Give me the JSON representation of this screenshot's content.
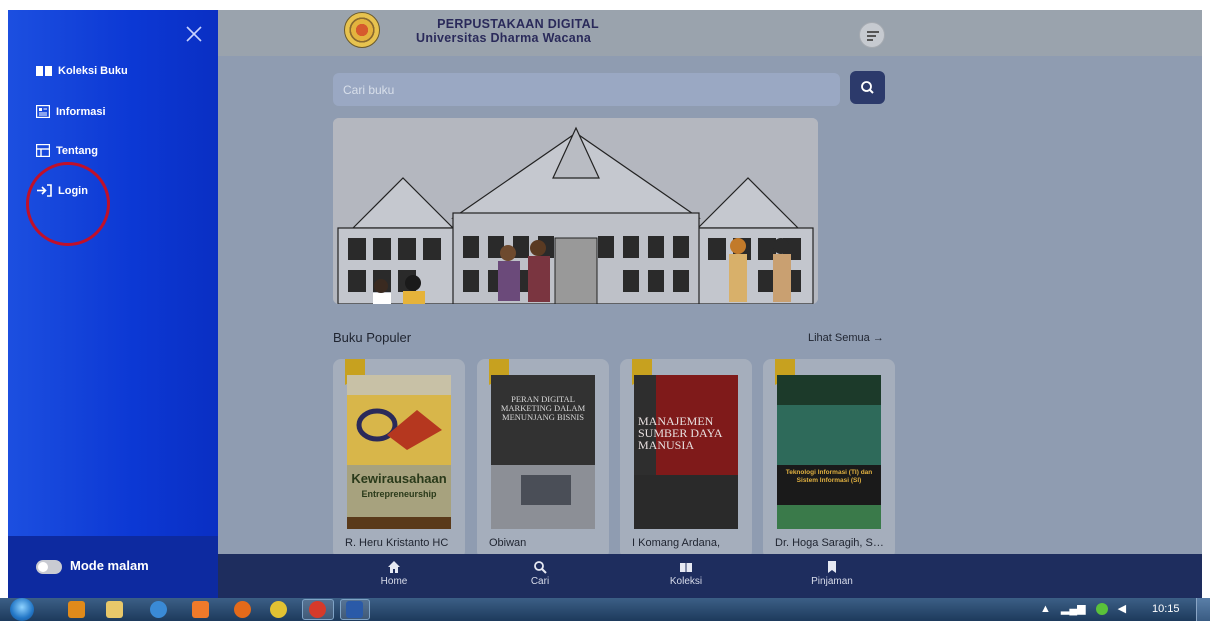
{
  "header": {
    "title": "PERPUSTAKAAN DIGITAL",
    "subtitle": "Universitas Dharma Wacana"
  },
  "search": {
    "placeholder": "Cari buku"
  },
  "sidebar": {
    "items": [
      {
        "label": "Koleksi Buku",
        "icon": "book-open-icon"
      },
      {
        "label": "Informasi",
        "icon": "newspaper-icon"
      },
      {
        "label": "Tentang",
        "icon": "info-card-icon"
      },
      {
        "label": "Login",
        "icon": "login-arrow-icon"
      }
    ],
    "night_mode_label": "Mode malam"
  },
  "popular": {
    "title": "Buku Populer",
    "see_all": "Lihat Semua →",
    "books": [
      {
        "author": "R. Heru Kristanto HC",
        "cover_title": "Kewirausahaan",
        "cover_sub": "Entrepreneurship"
      },
      {
        "author": "Obiwan",
        "cover_title": "PERAN DIGITAL MARKETING DALAM MENUNJANG BISNIS"
      },
      {
        "author": "I Komang Ardana,",
        "cover_title": "MANAJEMEN SUMBER DAYA MANUSIA"
      },
      {
        "author": "Dr. Hoga Saragih, S…",
        "cover_title": "Teknologi Informasi (TI) dan Sistem Informasi (SI)"
      }
    ]
  },
  "bottom_nav": [
    {
      "label": "Home",
      "icon": "home-icon"
    },
    {
      "label": "Cari",
      "icon": "search-icon"
    },
    {
      "label": "Koleksi",
      "icon": "book-icon"
    },
    {
      "label": "Pinjaman",
      "icon": "bookmark-icon"
    }
  ],
  "taskbar": {
    "clock": "10:15"
  },
  "colors": {
    "sidebar": "#0c38d4",
    "nav": "#1e2d5e",
    "search_button": "#2c3a6b",
    "highlight_circle": "#c0102a"
  }
}
